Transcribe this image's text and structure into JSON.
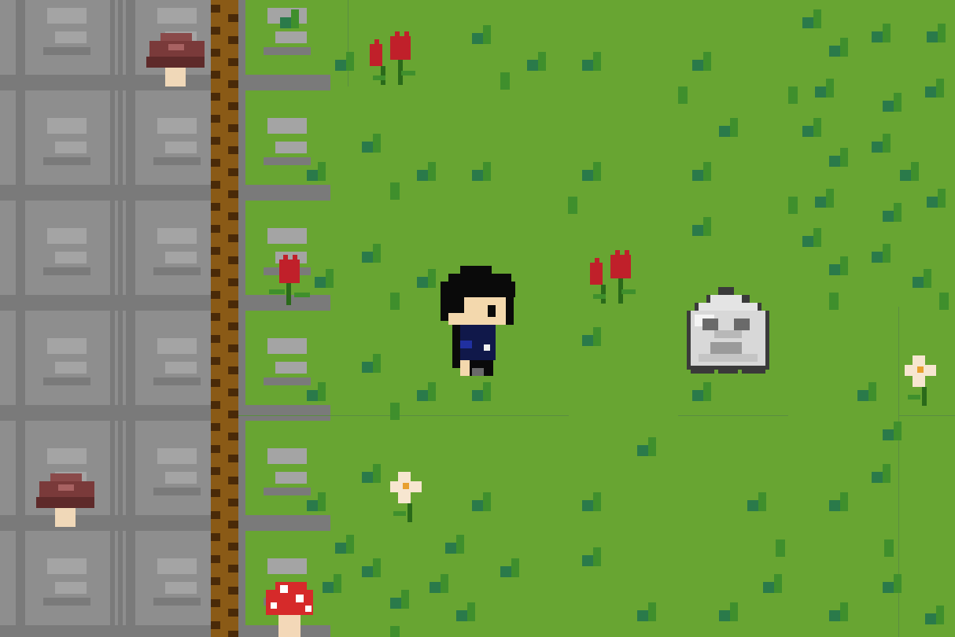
{
  "game": {
    "title": "",
    "colors": {
      "grass": "#68a532",
      "grass_tuft_dark": "#2a7a4a",
      "grass_tuft_mid": "#3f8f2c",
      "stone": "#8e8e8e",
      "stone_dark": "#7a7a7a",
      "stone_light": "#a4a4a4",
      "dirt_edge": "#8a5a16",
      "dirt_dark": "#4a2a08",
      "tulip_red": "#c0202a",
      "mushroom_brown": "#7a3a3a",
      "mushroom_red": "#d62a2a",
      "ghost_white": "#d8d8d8",
      "player_hair": "#0a0a0a",
      "player_coat": "#10184a"
    },
    "entities": {
      "player": {
        "name": "player-character",
        "icon": "dark-haired-kid-sprite"
      },
      "enemy": {
        "name": "ghost-enemy",
        "icon": "grey-ghost-sprite"
      },
      "decor": [
        "tulip-icon",
        "mushroom-icon",
        "daisy-icon",
        "red-spotted-mushroom-icon"
      ]
    }
  }
}
